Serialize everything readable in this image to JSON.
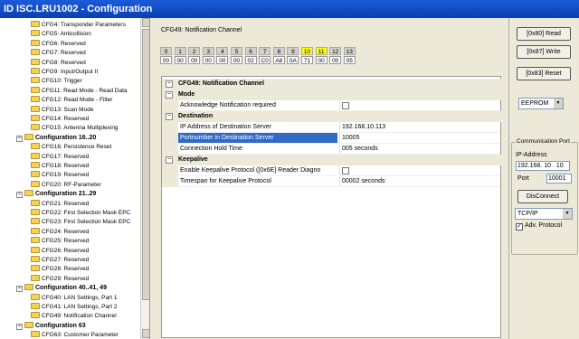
{
  "window": {
    "title": "ID ISC.LRU1002 - Configuration"
  },
  "tree": {
    "items": [
      {
        "label": "CFG4: Transponder Parameters",
        "group": false
      },
      {
        "label": "CFG5: Anticollision",
        "group": false
      },
      {
        "label": "CFG6: Reserved",
        "group": false
      },
      {
        "label": "CFG7: Reserved",
        "group": false
      },
      {
        "label": "CFG8: Reserved",
        "group": false
      },
      {
        "label": "CFG9: Input/Output II",
        "group": false
      },
      {
        "label": "CFG10: Trigger",
        "group": false
      },
      {
        "label": "CFG11: Read Mode - Read Data",
        "group": false
      },
      {
        "label": "CFG12: Read Mode - Filter",
        "group": false
      },
      {
        "label": "CFG13: Scan Mode",
        "group": false
      },
      {
        "label": "CFG14: Reserved",
        "group": false
      },
      {
        "label": "CFG15: Antenna Multiplexing",
        "group": false
      },
      {
        "label": "Configuration 16..20",
        "group": true
      },
      {
        "label": "CFG16: Persistence Reset",
        "group": false
      },
      {
        "label": "CFG17: Reserved",
        "group": false
      },
      {
        "label": "CFG18: Reserved",
        "group": false
      },
      {
        "label": "CFG19: Reserved",
        "group": false
      },
      {
        "label": "CFG20: RF-Parameter",
        "group": false
      },
      {
        "label": "Configuration 21..29",
        "group": true
      },
      {
        "label": "CFG21: Reserved",
        "group": false
      },
      {
        "label": "CFG22: First Selection Mask EPC",
        "group": false
      },
      {
        "label": "CFG23: First Selection Mask EPC",
        "group": false
      },
      {
        "label": "CFG24: Reserved",
        "group": false
      },
      {
        "label": "CFG25: Reserved",
        "group": false
      },
      {
        "label": "CFG26: Reserved",
        "group": false
      },
      {
        "label": "CFG27: Reserved",
        "group": false
      },
      {
        "label": "CFG28: Reserved",
        "group": false
      },
      {
        "label": "CFG29: Reserved",
        "group": false
      },
      {
        "label": "Configuration 40..41, 49",
        "group": true
      },
      {
        "label": "CFG40: LAN Settings, Part 1",
        "group": false
      },
      {
        "label": "CFG41: LAN Settings, Part 2",
        "group": false
      },
      {
        "label": "CFG49: Notification Channel",
        "group": false
      },
      {
        "label": "Configuration 63",
        "group": true
      },
      {
        "label": "CFG63: Customer Parameter",
        "group": false
      }
    ]
  },
  "center": {
    "cfg_label": "CFG49: Notification Channel",
    "byte_headers": [
      "0",
      "1",
      "2",
      "3",
      "4",
      "5",
      "6",
      "7",
      "8",
      "9",
      "10",
      "11",
      "12",
      "13"
    ],
    "byte_highlight": [
      10,
      11
    ],
    "byte_values": [
      "00",
      "00",
      "00",
      "00",
      "00",
      "00",
      "02",
      "C0",
      "A8",
      "0A",
      "71",
      "00",
      "00",
      "05"
    ],
    "grid_title": "CFG49: Notification Channel",
    "sections": {
      "mode": "Mode",
      "destination": "Destination",
      "keepalive": "Keepalive"
    },
    "rows": {
      "ack_name": "Acknowledge Notification required",
      "ip_name": "IP Address of Destination Server",
      "ip_value": "192.168.10.113",
      "port_name": "Portnumber in Destination Server",
      "port_value": "10005",
      "hold_name": "Connection Hold Time",
      "hold_value": "005 seconds",
      "keepalive_name": "Enable Keepalive Protocol ([0x6E] Reader Diagno",
      "timespan_name": "Timespan for Keepalive Protocol",
      "timespan_value": "00002 seconds"
    }
  },
  "right": {
    "read_button": "[0x80] Read",
    "write_button": "[0x87] Write",
    "reset_button": "[0x83] Reset",
    "memory_select": "EEPROM",
    "comm_title": "Communication Port",
    "ip_label": "IP-Address",
    "ip_value": "192.168. 10 . 10",
    "port_label": "Port",
    "port_value": "10001",
    "disconnect_button": "DisConnect",
    "protocol_select": "TCP/IP",
    "adv_protocol_label": "Adv. Protocol",
    "adv_protocol_checked": "✓"
  },
  "colors": {
    "selection": "#316ac5",
    "byte_highlight": "#ffff00",
    "titlebar": "#0a3fb0"
  }
}
